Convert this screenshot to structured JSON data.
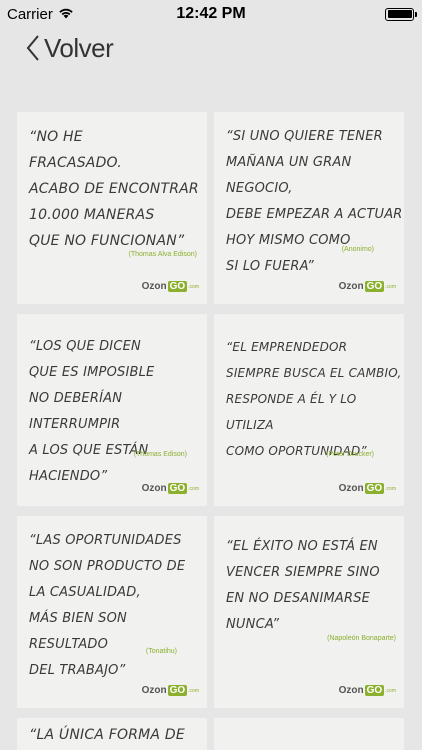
{
  "status": {
    "carrier": "Carrier",
    "time": "12:42 PM"
  },
  "nav": {
    "back_label": "Volver"
  },
  "quotes": [
    {
      "text": "“No he\nfracasado.\nAcabo de encontrar\n10.000 maneras\nque no funcionan”",
      "author": "(Thomas Alva Edison)"
    },
    {
      "text": "“Si uno quiere tener\nmañana un gran negocio,\ndebe empezar a actuar\nhoy mismo como\nsi lo fuera”",
      "author": "(Anonimo)"
    },
    {
      "text": "“Los que dicen\nque es imposible\nno deberían interrumpir\na los que están haciendo”",
      "author": "(Thomas Edison)"
    },
    {
      "text": "“El emprendedor\nsiempre busca el cambio,\nresponde a él y lo utiliza\ncomo oportunidad”",
      "author": "(Peter Drucker)"
    },
    {
      "text": "“Las oportunidades\nno son producto de\nla casualidad,\nmás bien son resultado\ndel trabajo”",
      "author": "(Tonatihu)"
    },
    {
      "text": "“El éxito no está en\nvencer siempre sino\nen no desanimarse\nnunca”",
      "author": "(Napoleón Bonaparte)"
    },
    {
      "text": "“La única forma de",
      "author": ""
    },
    {
      "text": "",
      "author": ""
    }
  ],
  "logo": {
    "ozon": "Ozon",
    "go": "GO",
    "com": ".com"
  }
}
